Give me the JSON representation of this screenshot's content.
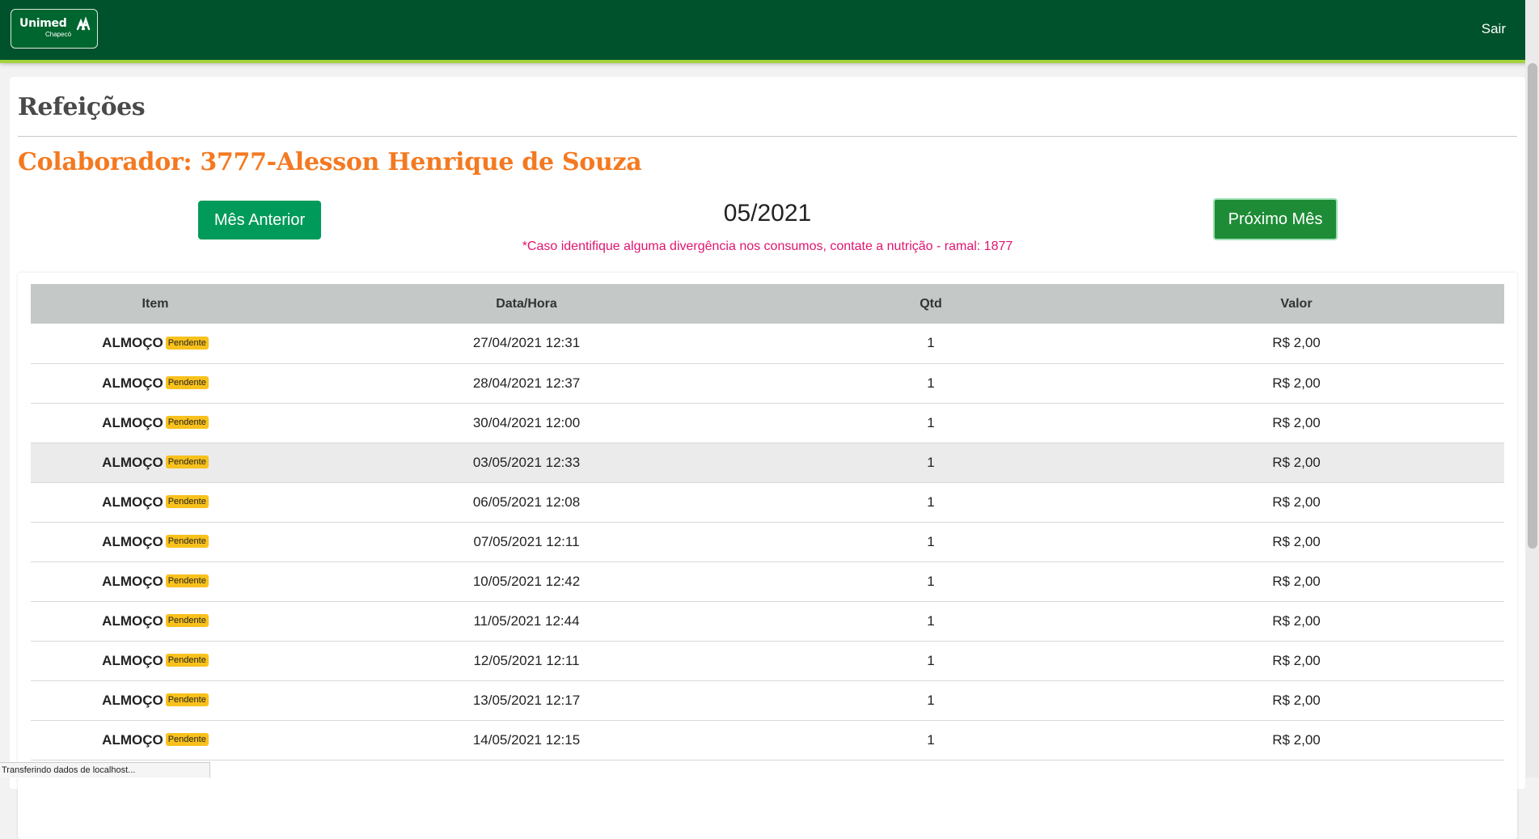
{
  "header": {
    "logo": {
      "brand": "Unimed",
      "sub": "Chapecó"
    },
    "logout_label": "Sair"
  },
  "page": {
    "title": "Refeições",
    "collaborator": "Colaborador: 3777-Alesson Henrique de Souza"
  },
  "nav": {
    "prev_label": "Mês Anterior",
    "next_label": "Próximo Mês",
    "current_month": "05/2021",
    "note": "*Caso identifique alguma divergência nos consumos, contate a nutrição - ramal: 1877"
  },
  "table": {
    "headers": [
      "Item",
      "Data/Hora",
      "Qtd",
      "Valor"
    ],
    "rows": [
      {
        "item": "ALMOÇO",
        "status": "Pendente",
        "datetime": "27/04/2021 12:31",
        "qty": "1",
        "value": "R$ 2,00"
      },
      {
        "item": "ALMOÇO",
        "status": "Pendente",
        "datetime": "28/04/2021 12:37",
        "qty": "1",
        "value": "R$ 2,00"
      },
      {
        "item": "ALMOÇO",
        "status": "Pendente",
        "datetime": "30/04/2021 12:00",
        "qty": "1",
        "value": "R$ 2,00"
      },
      {
        "item": "ALMOÇO",
        "status": "Pendente",
        "datetime": "03/05/2021 12:33",
        "qty": "1",
        "value": "R$ 2,00"
      },
      {
        "item": "ALMOÇO",
        "status": "Pendente",
        "datetime": "06/05/2021 12:08",
        "qty": "1",
        "value": "R$ 2,00"
      },
      {
        "item": "ALMOÇO",
        "status": "Pendente",
        "datetime": "07/05/2021 12:11",
        "qty": "1",
        "value": "R$ 2,00"
      },
      {
        "item": "ALMOÇO",
        "status": "Pendente",
        "datetime": "10/05/2021 12:42",
        "qty": "1",
        "value": "R$ 2,00"
      },
      {
        "item": "ALMOÇO",
        "status": "Pendente",
        "datetime": "11/05/2021 12:44",
        "qty": "1",
        "value": "R$ 2,00"
      },
      {
        "item": "ALMOÇO",
        "status": "Pendente",
        "datetime": "12/05/2021 12:11",
        "qty": "1",
        "value": "R$ 2,00"
      },
      {
        "item": "ALMOÇO",
        "status": "Pendente",
        "datetime": "13/05/2021 12:17",
        "qty": "1",
        "value": "R$ 2,00"
      },
      {
        "item": "ALMOÇO",
        "status": "Pendente",
        "datetime": "14/05/2021 12:15",
        "qty": "1",
        "value": "R$ 2,00"
      }
    ]
  },
  "status_bar": "Transferindo dados de localhost...",
  "colors": {
    "header_bg": "#00522c",
    "accent_line": "#a3d33a",
    "title_orange": "#f47920",
    "note_pink": "#e0156f",
    "badge_yellow": "#f8c11c",
    "prev_button": "#009a5a",
    "next_button": "#1e8c36"
  }
}
